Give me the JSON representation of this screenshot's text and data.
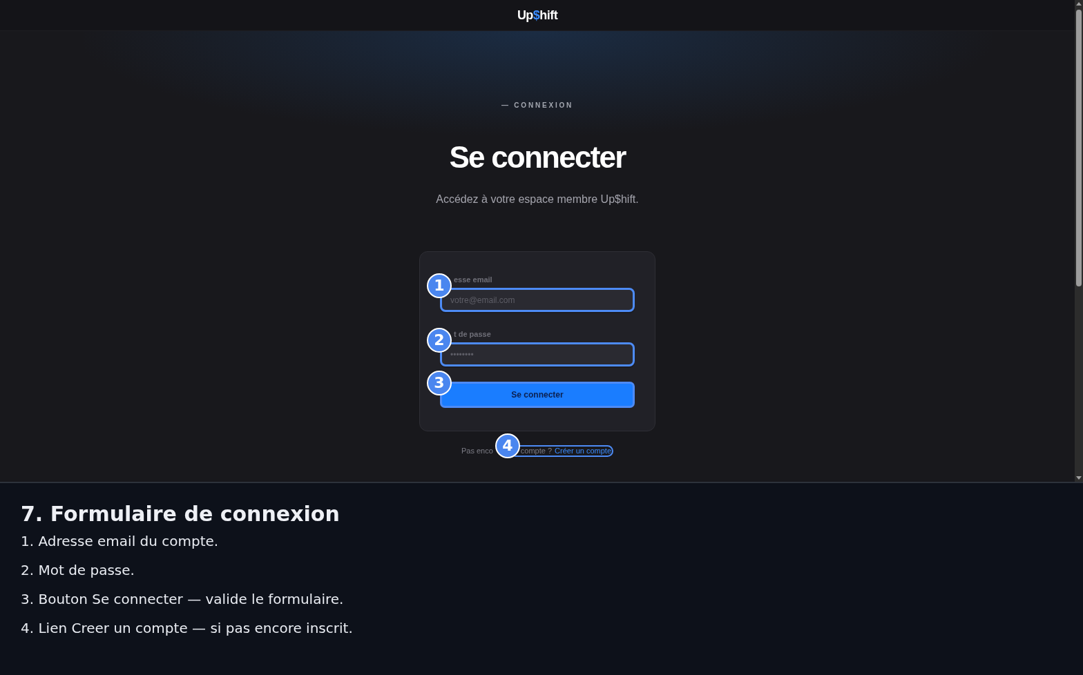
{
  "header": {
    "logo": {
      "start": "Up",
      "accent": "$",
      "end": "hift"
    }
  },
  "hero": {
    "eyebrow": "— CONNEXION",
    "title": "Se connecter",
    "subtitle": "Accédez à votre espace membre Up$hift."
  },
  "form": {
    "fields": [
      {
        "label": "esse email",
        "placeholder": "votre@email.com",
        "highlighted": true,
        "callout": "1"
      },
      {
        "label": "t de passe",
        "placeholder": "••••••••",
        "highlighted": true,
        "callout": "2"
      }
    ],
    "submit": {
      "label": "Se connecter",
      "highlighted": true,
      "callout": "3"
    }
  },
  "signup": {
    "prompt_start": "Pas enco",
    "prompt_end": "compte ?",
    "link": "Créer un compte",
    "highlighted": true,
    "callout": "4"
  },
  "caption": {
    "title": "7. Formulaire de connexion",
    "items": [
      "1. Adresse email du compte.",
      "2. Mot de passe.",
      "3. Bouton Se connecter — valide le formulaire.",
      "4. Lien Creer un compte — si pas encore inscrit."
    ]
  }
}
